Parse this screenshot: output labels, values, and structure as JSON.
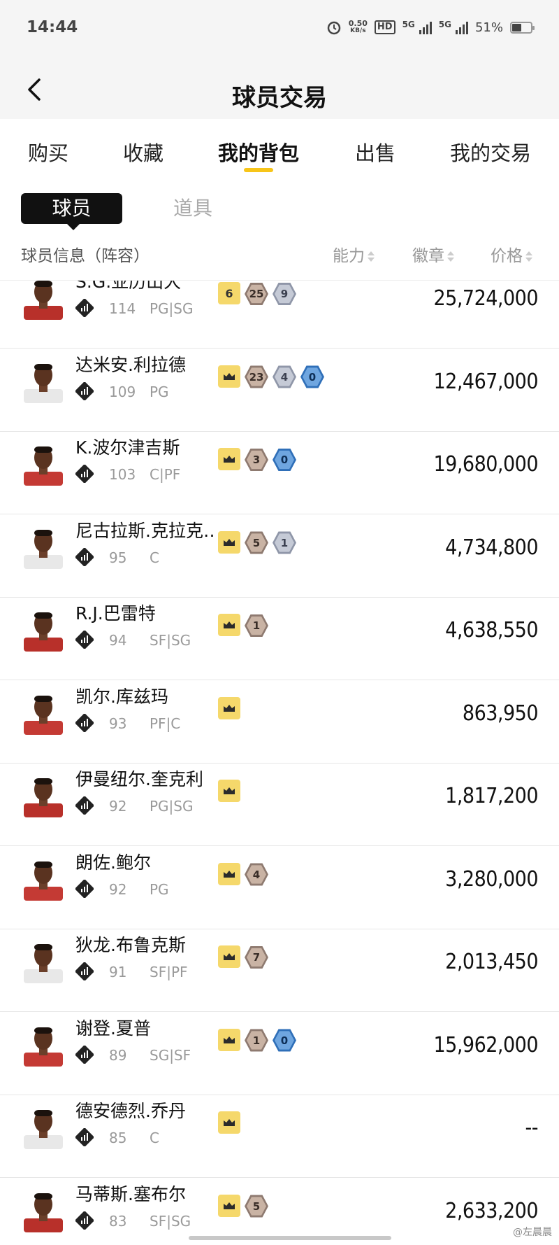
{
  "status": {
    "time": "14:44",
    "speed_top": "0.50",
    "speed_unit": "KB/s",
    "hd": "HD",
    "net1": "5G",
    "net2": "5G",
    "battery": "51%"
  },
  "header": {
    "title": "球员交易"
  },
  "tabs": [
    "购买",
    "收藏",
    "我的背包",
    "出售",
    "我的交易"
  ],
  "segments": {
    "active": "球员",
    "inactive": "道具"
  },
  "columns": {
    "info": "球员信息（阵容）",
    "ability": "能力",
    "badge": "徽章",
    "price": "价格"
  },
  "players": [
    {
      "name": "S.G.亚历山大",
      "rating": "114",
      "pos": "PG|SG",
      "badges": [
        {
          "t": "six",
          "v": "6"
        },
        {
          "t": "brown",
          "v": "25"
        },
        {
          "t": "silver",
          "v": "9"
        }
      ],
      "price": "25,724,000",
      "jersey": "#b8302a"
    },
    {
      "name": "达米安.利拉德",
      "rating": "109",
      "pos": "PG",
      "badges": [
        {
          "t": "crown",
          "v": ""
        },
        {
          "t": "brown",
          "v": "23"
        },
        {
          "t": "silver",
          "v": "4"
        },
        {
          "t": "blue",
          "v": "0"
        }
      ],
      "price": "12,467,000",
      "jersey": "#e8e8e8"
    },
    {
      "name": "K.波尔津吉斯",
      "rating": "103",
      "pos": "C|PF",
      "badges": [
        {
          "t": "crown",
          "v": ""
        },
        {
          "t": "brown",
          "v": "3"
        },
        {
          "t": "blue",
          "v": "0"
        }
      ],
      "price": "19,680,000",
      "jersey": "#c43a34"
    },
    {
      "name": "尼古拉斯.克拉克…",
      "rating": "95",
      "pos": "C",
      "badges": [
        {
          "t": "crown",
          "v": ""
        },
        {
          "t": "brown",
          "v": "5"
        },
        {
          "t": "silver",
          "v": "1"
        }
      ],
      "price": "4,734,800",
      "jersey": "#e8e8e8"
    },
    {
      "name": "R.J.巴雷特",
      "rating": "94",
      "pos": "SF|SG",
      "badges": [
        {
          "t": "crown",
          "v": ""
        },
        {
          "t": "brown",
          "v": "1"
        }
      ],
      "price": "4,638,550",
      "jersey": "#b8302a"
    },
    {
      "name": "凯尔.库兹玛",
      "rating": "93",
      "pos": "PF|C",
      "badges": [
        {
          "t": "crown",
          "v": ""
        }
      ],
      "price": "863,950",
      "jersey": "#c43a34"
    },
    {
      "name": "伊曼纽尔.奎克利",
      "rating": "92",
      "pos": "PG|SG",
      "badges": [
        {
          "t": "crown",
          "v": ""
        }
      ],
      "price": "1,817,200",
      "jersey": "#b8302a"
    },
    {
      "name": "朗佐.鲍尔",
      "rating": "92",
      "pos": "PG",
      "badges": [
        {
          "t": "crown",
          "v": ""
        },
        {
          "t": "brown",
          "v": "4"
        }
      ],
      "price": "3,280,000",
      "jersey": "#c43a34"
    },
    {
      "name": "狄龙.布鲁克斯",
      "rating": "91",
      "pos": "SF|PF",
      "badges": [
        {
          "t": "crown",
          "v": ""
        },
        {
          "t": "brown",
          "v": "7"
        }
      ],
      "price": "2,013,450",
      "jersey": "#e8e8e8"
    },
    {
      "name": "谢登.夏普",
      "rating": "89",
      "pos": "SG|SF",
      "badges": [
        {
          "t": "crown",
          "v": ""
        },
        {
          "t": "brown",
          "v": "1"
        },
        {
          "t": "blue",
          "v": "0"
        }
      ],
      "price": "15,962,000",
      "jersey": "#c43a34"
    },
    {
      "name": "德安德烈.乔丹",
      "rating": "85",
      "pos": "C",
      "badges": [
        {
          "t": "crown",
          "v": ""
        }
      ],
      "price": "--",
      "jersey": "#e8e8e8"
    },
    {
      "name": "马蒂斯.塞布尔",
      "rating": "83",
      "pos": "SF|SG",
      "badges": [
        {
          "t": "crown",
          "v": ""
        },
        {
          "t": "brown",
          "v": "5"
        }
      ],
      "price": "2,633,200",
      "jersey": "#b8302a"
    }
  ],
  "watermark": "@左晨晨"
}
